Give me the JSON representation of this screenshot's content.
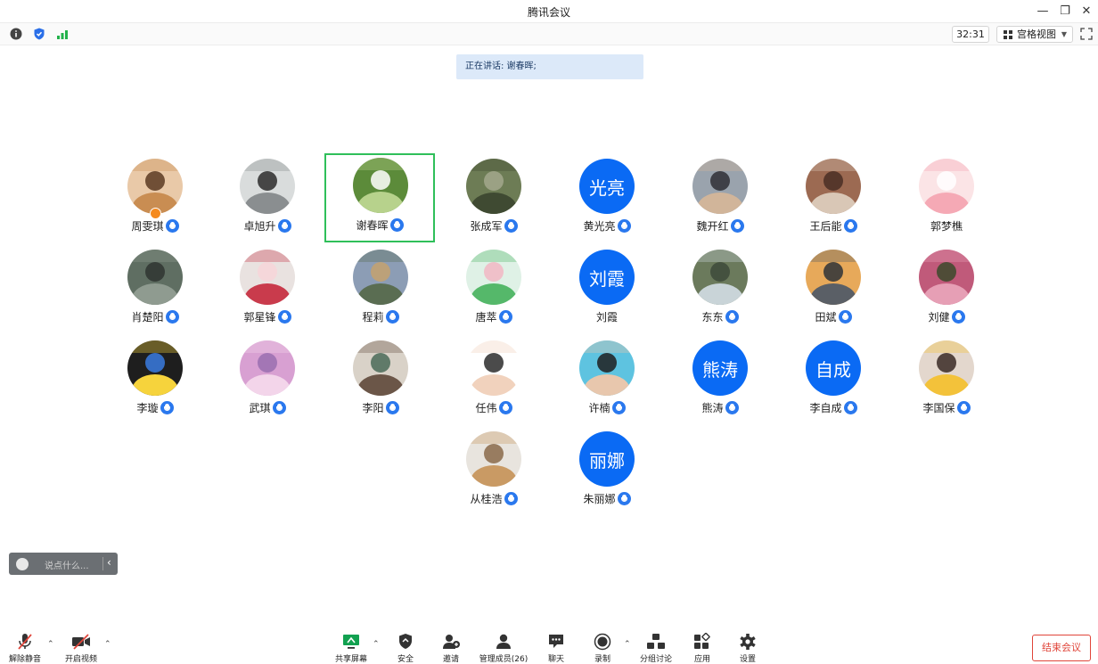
{
  "window": {
    "title": "腾讯会议",
    "minimize": "—",
    "restore": "❐",
    "close": "✕"
  },
  "infobar": {
    "timer": "32:31",
    "view_mode": "宫格视图"
  },
  "speaking": {
    "text": "正在讲话: 谢春晖;"
  },
  "participants": [
    {
      "name": "周雯琪",
      "avatar": "photo-cat",
      "host": true
    },
    {
      "name": "卓旭升",
      "avatar": "photo-man"
    },
    {
      "name": "谢春晖",
      "avatar": "photo-flower",
      "active": true
    },
    {
      "name": "张成军",
      "avatar": "photo-landscape"
    },
    {
      "name": "黄光亮",
      "avatar_text": "光亮"
    },
    {
      "name": "魏开红",
      "avatar": "photo-man-office"
    },
    {
      "name": "王后能",
      "avatar": "photo-hands"
    },
    {
      "name": "郭梦樵",
      "avatar": "photo-pink-cartoon",
      "no_mic": true
    },
    {
      "name": "肖楚阳",
      "avatar": "photo-binoculars"
    },
    {
      "name": "郭星锋",
      "avatar": "photo-toy"
    },
    {
      "name": "程莉",
      "avatar": "photo-coast"
    },
    {
      "name": "唐萃",
      "avatar": "photo-anime-girl"
    },
    {
      "name": "刘霞",
      "avatar_text": "刘霞",
      "no_mic": true
    },
    {
      "name": "东东",
      "avatar": "photo-waterfall"
    },
    {
      "name": "田斌",
      "avatar": "photo-sunset"
    },
    {
      "name": "刘健",
      "avatar": "photo-pink-flowers"
    },
    {
      "name": "李璇",
      "avatar": "photo-piano"
    },
    {
      "name": "武琪",
      "avatar": "photo-festival"
    },
    {
      "name": "李阳",
      "avatar": "photo-girl-back"
    },
    {
      "name": "任伟",
      "avatar": "photo-cartoon-boy"
    },
    {
      "name": "许楠",
      "avatar": "photo-young-man"
    },
    {
      "name": "熊涛",
      "avatar_text": "熊涛"
    },
    {
      "name": "李自成",
      "avatar_text": "自成"
    },
    {
      "name": "李国保",
      "avatar": "photo-family"
    },
    {
      "name": "从桂浩",
      "avatar": "photo-white-cat"
    },
    {
      "name": "朱丽娜",
      "avatar_text": "丽娜"
    }
  ],
  "chat": {
    "placeholder": "说点什么...",
    "collapse": "‹"
  },
  "toolbar": {
    "unmute": "解除静音",
    "start_video": "开启视频",
    "share_screen": "共享屏幕",
    "security": "安全",
    "invite": "邀请",
    "manage_members": "管理成员(26)",
    "chat": "聊天",
    "record": "录制",
    "breakout": "分组讨论",
    "apps": "应用",
    "settings": "设置",
    "end_meeting": "结束会议"
  },
  "colors": {
    "accent": "#0a6af4",
    "active_border": "#2fbf5a",
    "end": "#e0453a"
  }
}
